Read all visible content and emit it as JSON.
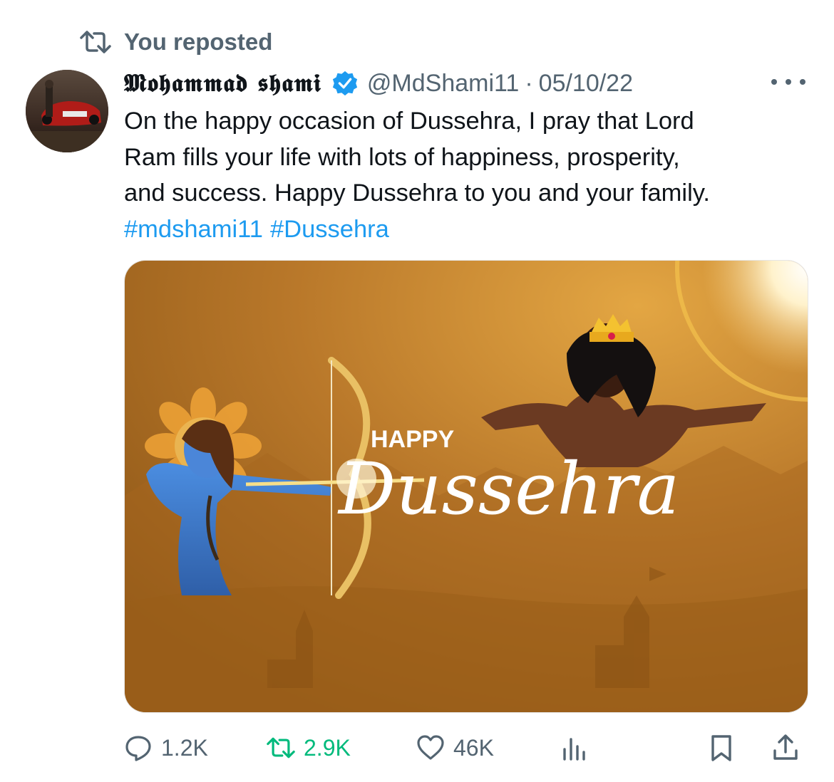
{
  "repost_banner": {
    "label": "You reposted"
  },
  "tweet": {
    "author_name": "𝕸𝖔𝖍𝖆𝖒𝖒𝖆𝖉 𝖘𝖍𝖆𝖒𝖎",
    "handle": "@MdShami11",
    "separator": "·",
    "date": "05/10/22",
    "text_lines": [
      "On the happy occasion of Dussehra, I pray that Lord",
      "Ram fills your life with lots of happiness, prosperity,",
      "and success. Happy Dussehra to you and your family."
    ],
    "hashtags": [
      "#mdshami11",
      "#Dussehra"
    ]
  },
  "media": {
    "happy_text": "HAPPY",
    "script_text": "Dussehra"
  },
  "actions": {
    "replies": "1.2K",
    "reposts": "2.9K",
    "likes": "46K"
  },
  "icons": [
    "repost-icon",
    "verified-badge-icon",
    "more-icon",
    "reply-icon",
    "repost-icon",
    "like-icon",
    "views-icon",
    "bookmark-icon",
    "share-icon"
  ],
  "colors": {
    "link": "#1d9bf0",
    "reposted": "#00ba7c",
    "muted": "#536471",
    "text": "#0f1419"
  }
}
